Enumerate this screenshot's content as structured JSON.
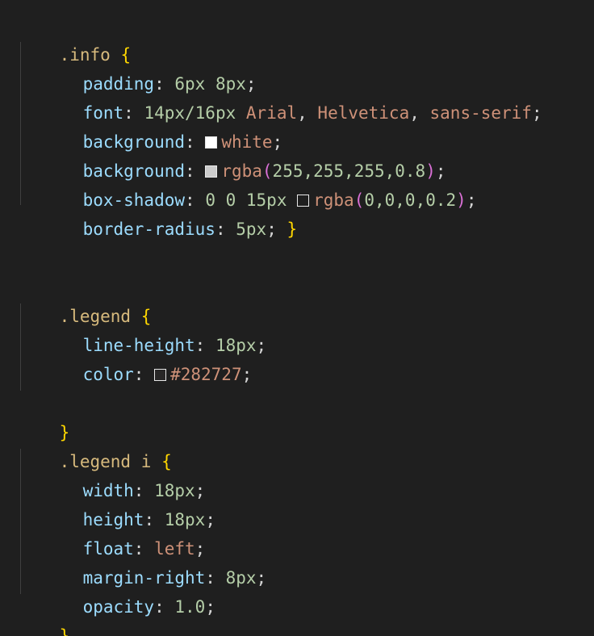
{
  "code": {
    "info": {
      "selector": ".info",
      "open": "{",
      "padding": {
        "prop": "padding",
        "value": "6px 8px"
      },
      "font": {
        "prop": "font",
        "size": "14px/16px",
        "fam1": "Arial",
        "fam2": "Helvetica",
        "fam3": "sans-serif"
      },
      "bg1": {
        "prop": "background",
        "value": "white",
        "swatch": "#ffffff"
      },
      "bg2": {
        "prop": "background",
        "fn": "rgba",
        "args": "255,255,255,0.8",
        "swatch": "#cccccc"
      },
      "shadow": {
        "prop": "box-shadow",
        "nums": "0 0 15px",
        "fn": "rgba",
        "args": "0,0,0,0.2",
        "swatch": "#1f1f1f"
      },
      "radius": {
        "prop": "border-radius",
        "value": "5px",
        "close": "}"
      }
    },
    "legend": {
      "selector": ".legend",
      "open": "{",
      "line_height": {
        "prop": "line-height",
        "value": "18px"
      },
      "color": {
        "prop": "color",
        "value": "#282727",
        "swatch": "#282727"
      },
      "close": "}"
    },
    "legend_i": {
      "selector": ".legend",
      "tag": "i",
      "open": "{",
      "width": {
        "prop": "width",
        "value": "18px"
      },
      "height": {
        "prop": "height",
        "value": "18px"
      },
      "float": {
        "prop": "float",
        "value": "left"
      },
      "margin_right": {
        "prop": "margin-right",
        "value": "8px"
      },
      "opacity": {
        "prop": "opacity",
        "value": "1.0"
      },
      "close": "}"
    }
  },
  "colors": {
    "background": "#1f1f1f",
    "selector": "#d7ba7d",
    "brace": "#ffd700",
    "property": "#9cdcfe",
    "number": "#b5cea8",
    "string_value": "#ce9178",
    "paren": "#da70d6"
  }
}
